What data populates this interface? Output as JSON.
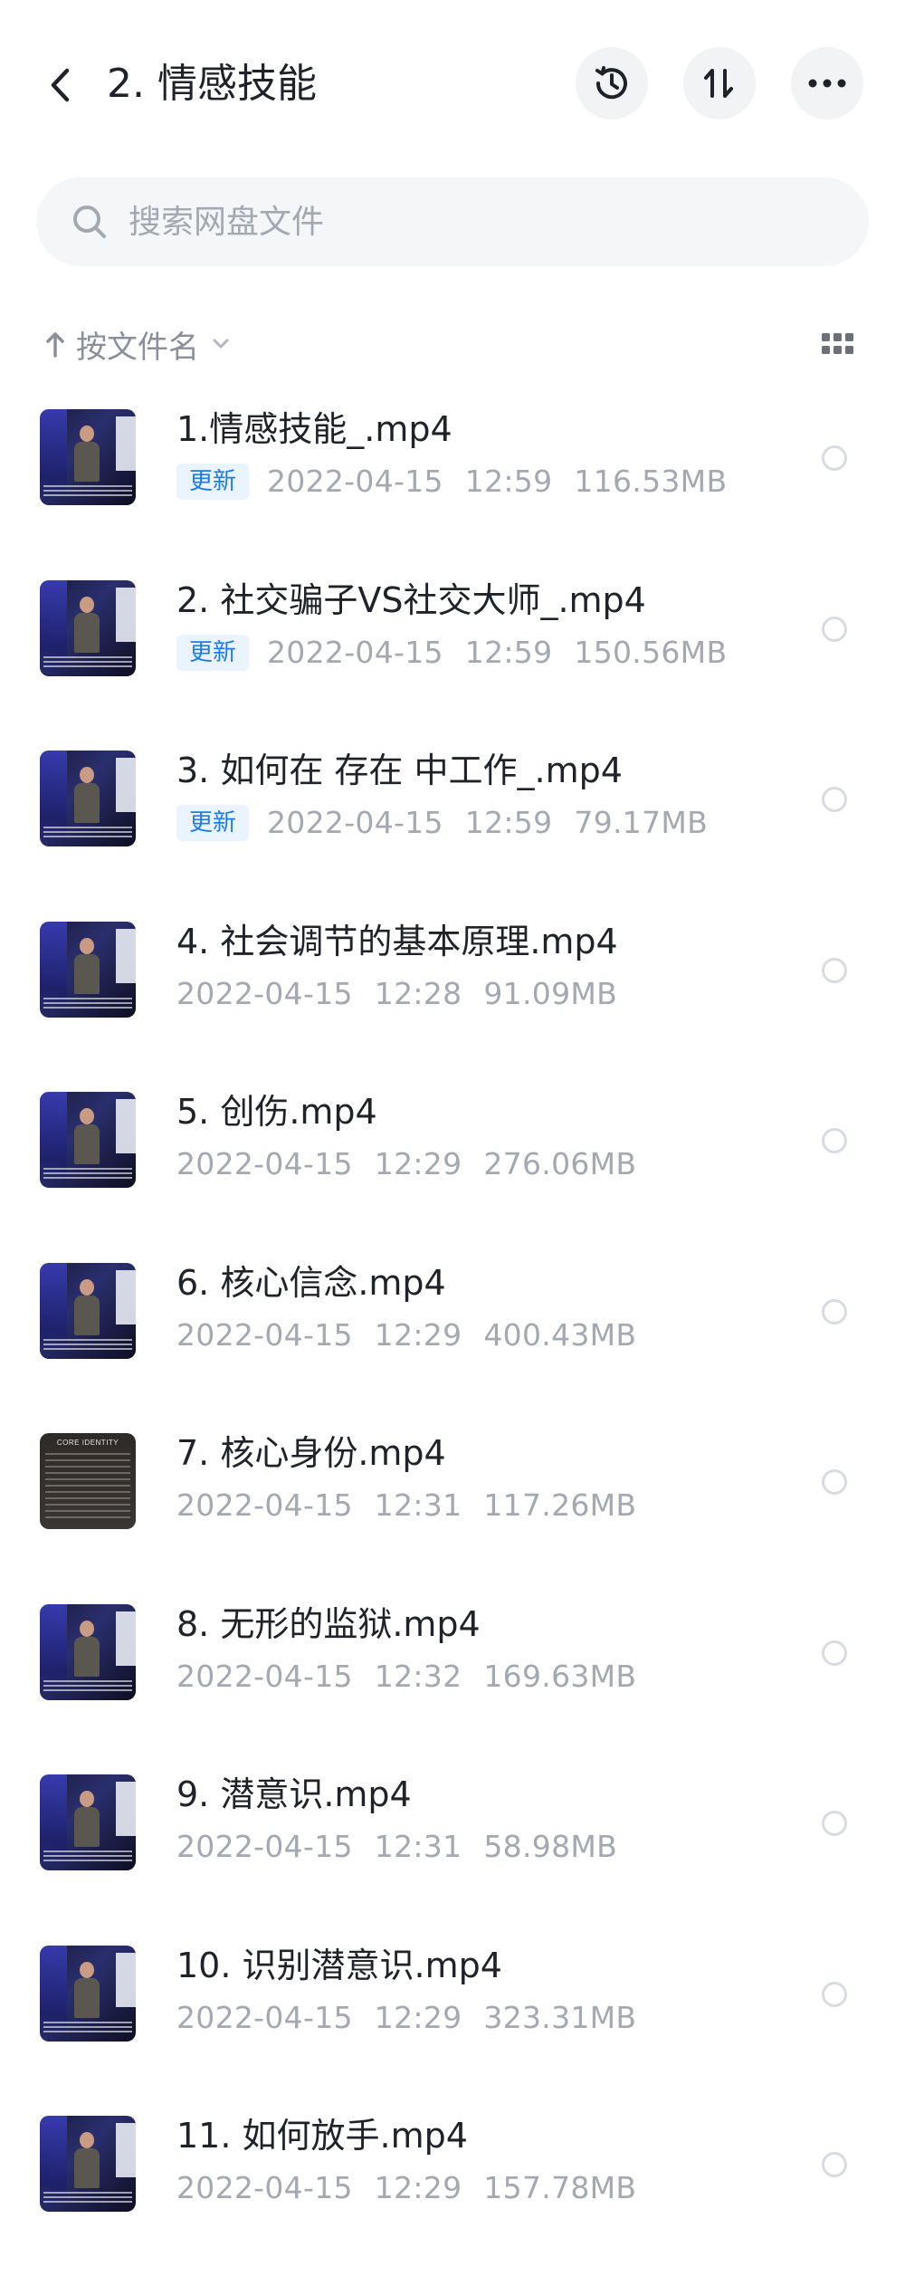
{
  "header": {
    "title": "2. 情感技能",
    "back_icon": "chevron-left-icon",
    "actions": [
      {
        "name": "history",
        "icon": "clock-history-icon"
      },
      {
        "name": "sort",
        "icon": "sort-up-down-icon"
      },
      {
        "name": "more",
        "icon": "more-horizontal-icon"
      }
    ]
  },
  "search": {
    "placeholder": "搜索网盘文件",
    "value": ""
  },
  "sort_bar": {
    "label": "按文件名",
    "direction_icon": "arrow-up-icon",
    "dropdown_icon": "chevron-down-icon",
    "view_icon": "grid-view-icon"
  },
  "colors": {
    "accent_blue": "#1e7ce6",
    "badge_bg": "#eaf4ff",
    "meta_gray": "#a3a8b1",
    "title_black": "#1f2329"
  },
  "files": [
    {
      "name": "1.情感技能_.mp4",
      "badge": "更新",
      "date": "2022-04-15",
      "time": "12:59",
      "size": "116.53MB"
    },
    {
      "name": "2. 社交骗子VS社交大师_.mp4",
      "badge": "更新",
      "date": "2022-04-15",
      "time": "12:59",
      "size": "150.56MB"
    },
    {
      "name": "3. 如何在 存在 中工作_.mp4",
      "badge": "更新",
      "date": "2022-04-15",
      "time": "12:59",
      "size": "79.17MB"
    },
    {
      "name": "4. 社会调节的基本原理.mp4",
      "badge": null,
      "date": "2022-04-15",
      "time": "12:28",
      "size": "91.09MB"
    },
    {
      "name": "5. 创伤.mp4",
      "badge": null,
      "date": "2022-04-15",
      "time": "12:29",
      "size": "276.06MB"
    },
    {
      "name": "6. 核心信念.mp4",
      "badge": null,
      "date": "2022-04-15",
      "time": "12:29",
      "size": "400.43MB"
    },
    {
      "name": "7. 核心身份.mp4",
      "badge": null,
      "date": "2022-04-15",
      "time": "12:31",
      "size": "117.26MB",
      "thumb_text": "CORE IDENTITY"
    },
    {
      "name": "8. 无形的监狱.mp4",
      "badge": null,
      "date": "2022-04-15",
      "time": "12:32",
      "size": "169.63MB"
    },
    {
      "name": "9. 潜意识.mp4",
      "badge": null,
      "date": "2022-04-15",
      "time": "12:31",
      "size": "58.98MB"
    },
    {
      "name": "10. 识别潜意识.mp4",
      "badge": null,
      "date": "2022-04-15",
      "time": "12:29",
      "size": "323.31MB"
    },
    {
      "name": "11. 如何放手.mp4",
      "badge": null,
      "date": "2022-04-15",
      "time": "12:29",
      "size": "157.78MB"
    }
  ]
}
